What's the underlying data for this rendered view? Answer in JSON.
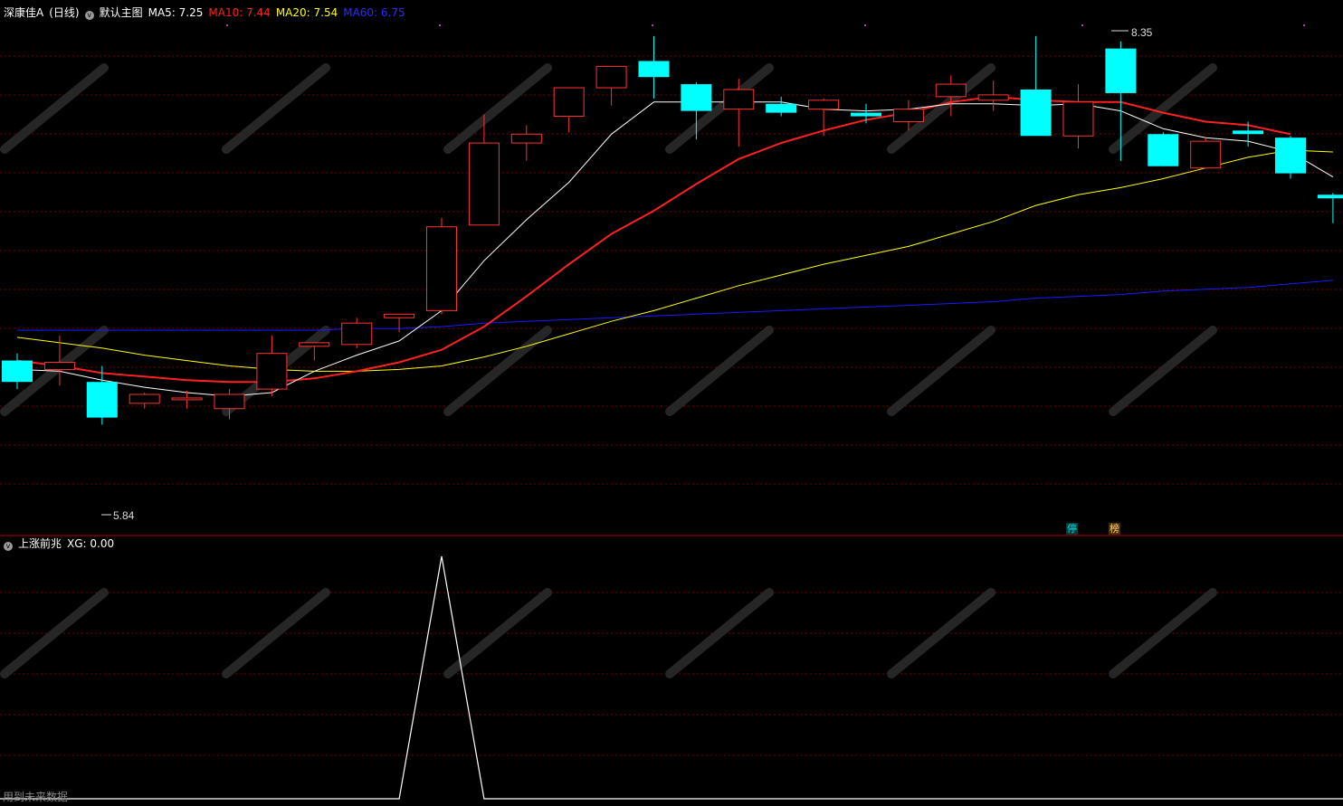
{
  "main_header": {
    "stock": "深康佳A",
    "period": "(日线)",
    "template": "默认主图",
    "ma5": "MA5: 7.25",
    "ma10": "MA10: 7.44",
    "ma20": "MA20: 7.54",
    "ma60": "MA60: 6.75"
  },
  "sub_header": {
    "indicator": "上涨前兆",
    "value": "XG: 0.00"
  },
  "footer_text": "用到未来数据",
  "markers": {
    "high_label": "8.35",
    "low_label": "5.84",
    "tag_stop": "停",
    "tag_list": "榜"
  },
  "colors": {
    "up": "#ff3232",
    "down": "#00ffff",
    "ma5": "#ffffff",
    "ma10": "#ff2020",
    "ma20": "#ffff00",
    "ma60": "#1a1aff",
    "grid": "#7a0000"
  },
  "chart_data": [
    {
      "type": "candlestick",
      "ylim": [
        5.7,
        8.45
      ],
      "candles": [
        {
          "o": 6.58,
          "h": 6.62,
          "l": 6.42,
          "c": 6.46
        },
        {
          "o": 6.53,
          "h": 6.72,
          "l": 6.44,
          "c": 6.57
        },
        {
          "o": 6.46,
          "h": 6.55,
          "l": 6.22,
          "c": 6.26
        },
        {
          "o": 6.34,
          "h": 6.4,
          "l": 6.31,
          "c": 6.39
        },
        {
          "o": 6.36,
          "h": 6.41,
          "l": 6.31,
          "c": 6.37
        },
        {
          "o": 6.31,
          "h": 6.42,
          "l": 6.25,
          "c": 6.39
        },
        {
          "o": 6.42,
          "h": 6.72,
          "l": 6.38,
          "c": 6.62
        },
        {
          "o": 6.66,
          "h": 6.68,
          "l": 6.58,
          "c": 6.68
        },
        {
          "o": 6.67,
          "h": 6.82,
          "l": 6.65,
          "c": 6.79
        },
        {
          "o": 6.82,
          "h": 6.84,
          "l": 6.74,
          "c": 6.84
        },
        {
          "o": 6.86,
          "h": 7.38,
          "l": 6.84,
          "c": 7.33
        },
        {
          "o": 7.34,
          "h": 7.96,
          "l": 7.34,
          "c": 7.8
        },
        {
          "o": 7.8,
          "h": 7.9,
          "l": 7.7,
          "c": 7.85
        },
        {
          "o": 7.95,
          "h": 8.08,
          "l": 7.86,
          "c": 8.11
        },
        {
          "o": 8.11,
          "h": 8.22,
          "l": 8.01,
          "c": 8.23
        },
        {
          "o": 8.26,
          "h": 8.4,
          "l": 8.05,
          "c": 8.17
        },
        {
          "o": 8.13,
          "h": 8.14,
          "l": 7.82,
          "c": 7.98
        },
        {
          "o": 7.99,
          "h": 8.16,
          "l": 7.78,
          "c": 8.1
        },
        {
          "o": 8.02,
          "h": 8.06,
          "l": 7.95,
          "c": 7.97
        },
        {
          "o": 7.99,
          "h": 8.05,
          "l": 7.84,
          "c": 8.04
        },
        {
          "o": 7.97,
          "h": 8.02,
          "l": 7.91,
          "c": 7.95
        },
        {
          "o": 7.92,
          "h": 8.04,
          "l": 7.87,
          "c": 7.99
        },
        {
          "o": 8.06,
          "h": 8.18,
          "l": 7.95,
          "c": 8.13
        },
        {
          "o": 8.04,
          "h": 8.15,
          "l": 7.98,
          "c": 8.07
        },
        {
          "o": 8.1,
          "h": 8.4,
          "l": 7.86,
          "c": 7.84
        },
        {
          "o": 7.84,
          "h": 8.13,
          "l": 7.77,
          "c": 8.03
        },
        {
          "o": 8.33,
          "h": 8.37,
          "l": 7.7,
          "c": 8.08
        },
        {
          "o": 7.85,
          "h": 7.86,
          "l": 7.67,
          "c": 7.67
        },
        {
          "o": 7.66,
          "h": 7.83,
          "l": 7.66,
          "c": 7.81
        },
        {
          "o": 7.87,
          "h": 7.92,
          "l": 7.78,
          "c": 7.85
        },
        {
          "o": 7.83,
          "h": 7.84,
          "l": 7.6,
          "c": 7.63
        },
        {
          "o": 7.51,
          "h": 7.52,
          "l": 7.35,
          "c": 7.49
        }
      ],
      "ma5": [
        6.53,
        6.52,
        6.47,
        6.43,
        6.4,
        6.38,
        6.4,
        6.52,
        6.61,
        6.69,
        6.86,
        7.14,
        7.37,
        7.58,
        7.85,
        8.03,
        8.03,
        8.03,
        8.03,
        7.99,
        7.98,
        7.99,
        8.02,
        8.02,
        8.01,
        8.02,
        7.98,
        7.88,
        7.83,
        7.81,
        7.75,
        7.61
      ],
      "ma10": [
        6.58,
        6.55,
        6.51,
        6.49,
        6.47,
        6.46,
        6.46,
        6.48,
        6.52,
        6.57,
        6.64,
        6.77,
        6.94,
        7.12,
        7.29,
        7.42,
        7.57,
        7.71,
        7.8,
        7.87,
        7.93,
        7.97,
        8.03,
        8.06,
        8.04,
        8.03,
        8.03,
        7.97,
        7.92,
        7.9,
        7.85
      ],
      "ma20": [
        6.71,
        6.68,
        6.65,
        6.61,
        6.58,
        6.55,
        6.53,
        6.52,
        6.52,
        6.53,
        6.55,
        6.6,
        6.66,
        6.73,
        6.8,
        6.86,
        6.93,
        7.0,
        7.06,
        7.12,
        7.17,
        7.22,
        7.29,
        7.36,
        7.45,
        7.51,
        7.55,
        7.6,
        7.66,
        7.72,
        7.76,
        7.75
      ],
      "ma60": [
        6.75,
        6.75,
        6.75,
        6.75,
        6.75,
        6.75,
        6.75,
        6.75,
        6.76,
        6.76,
        6.77,
        6.79,
        6.8,
        6.81,
        6.82,
        6.83,
        6.84,
        6.85,
        6.86,
        6.87,
        6.88,
        6.89,
        6.9,
        6.91,
        6.93,
        6.94,
        6.95,
        6.97,
        6.98,
        6.99,
        7.01,
        7.03
      ]
    },
    {
      "type": "line",
      "title": "上涨前兆",
      "series": [
        {
          "name": "XG",
          "values": [
            0,
            0,
            0,
            0,
            0,
            0,
            0,
            0,
            0,
            0,
            1,
            0,
            0,
            0,
            0,
            0,
            0,
            0,
            0,
            0,
            0,
            0,
            0,
            0,
            0,
            0,
            0,
            0,
            0,
            0,
            0,
            0
          ]
        }
      ],
      "ylim": [
        0,
        1
      ]
    }
  ]
}
